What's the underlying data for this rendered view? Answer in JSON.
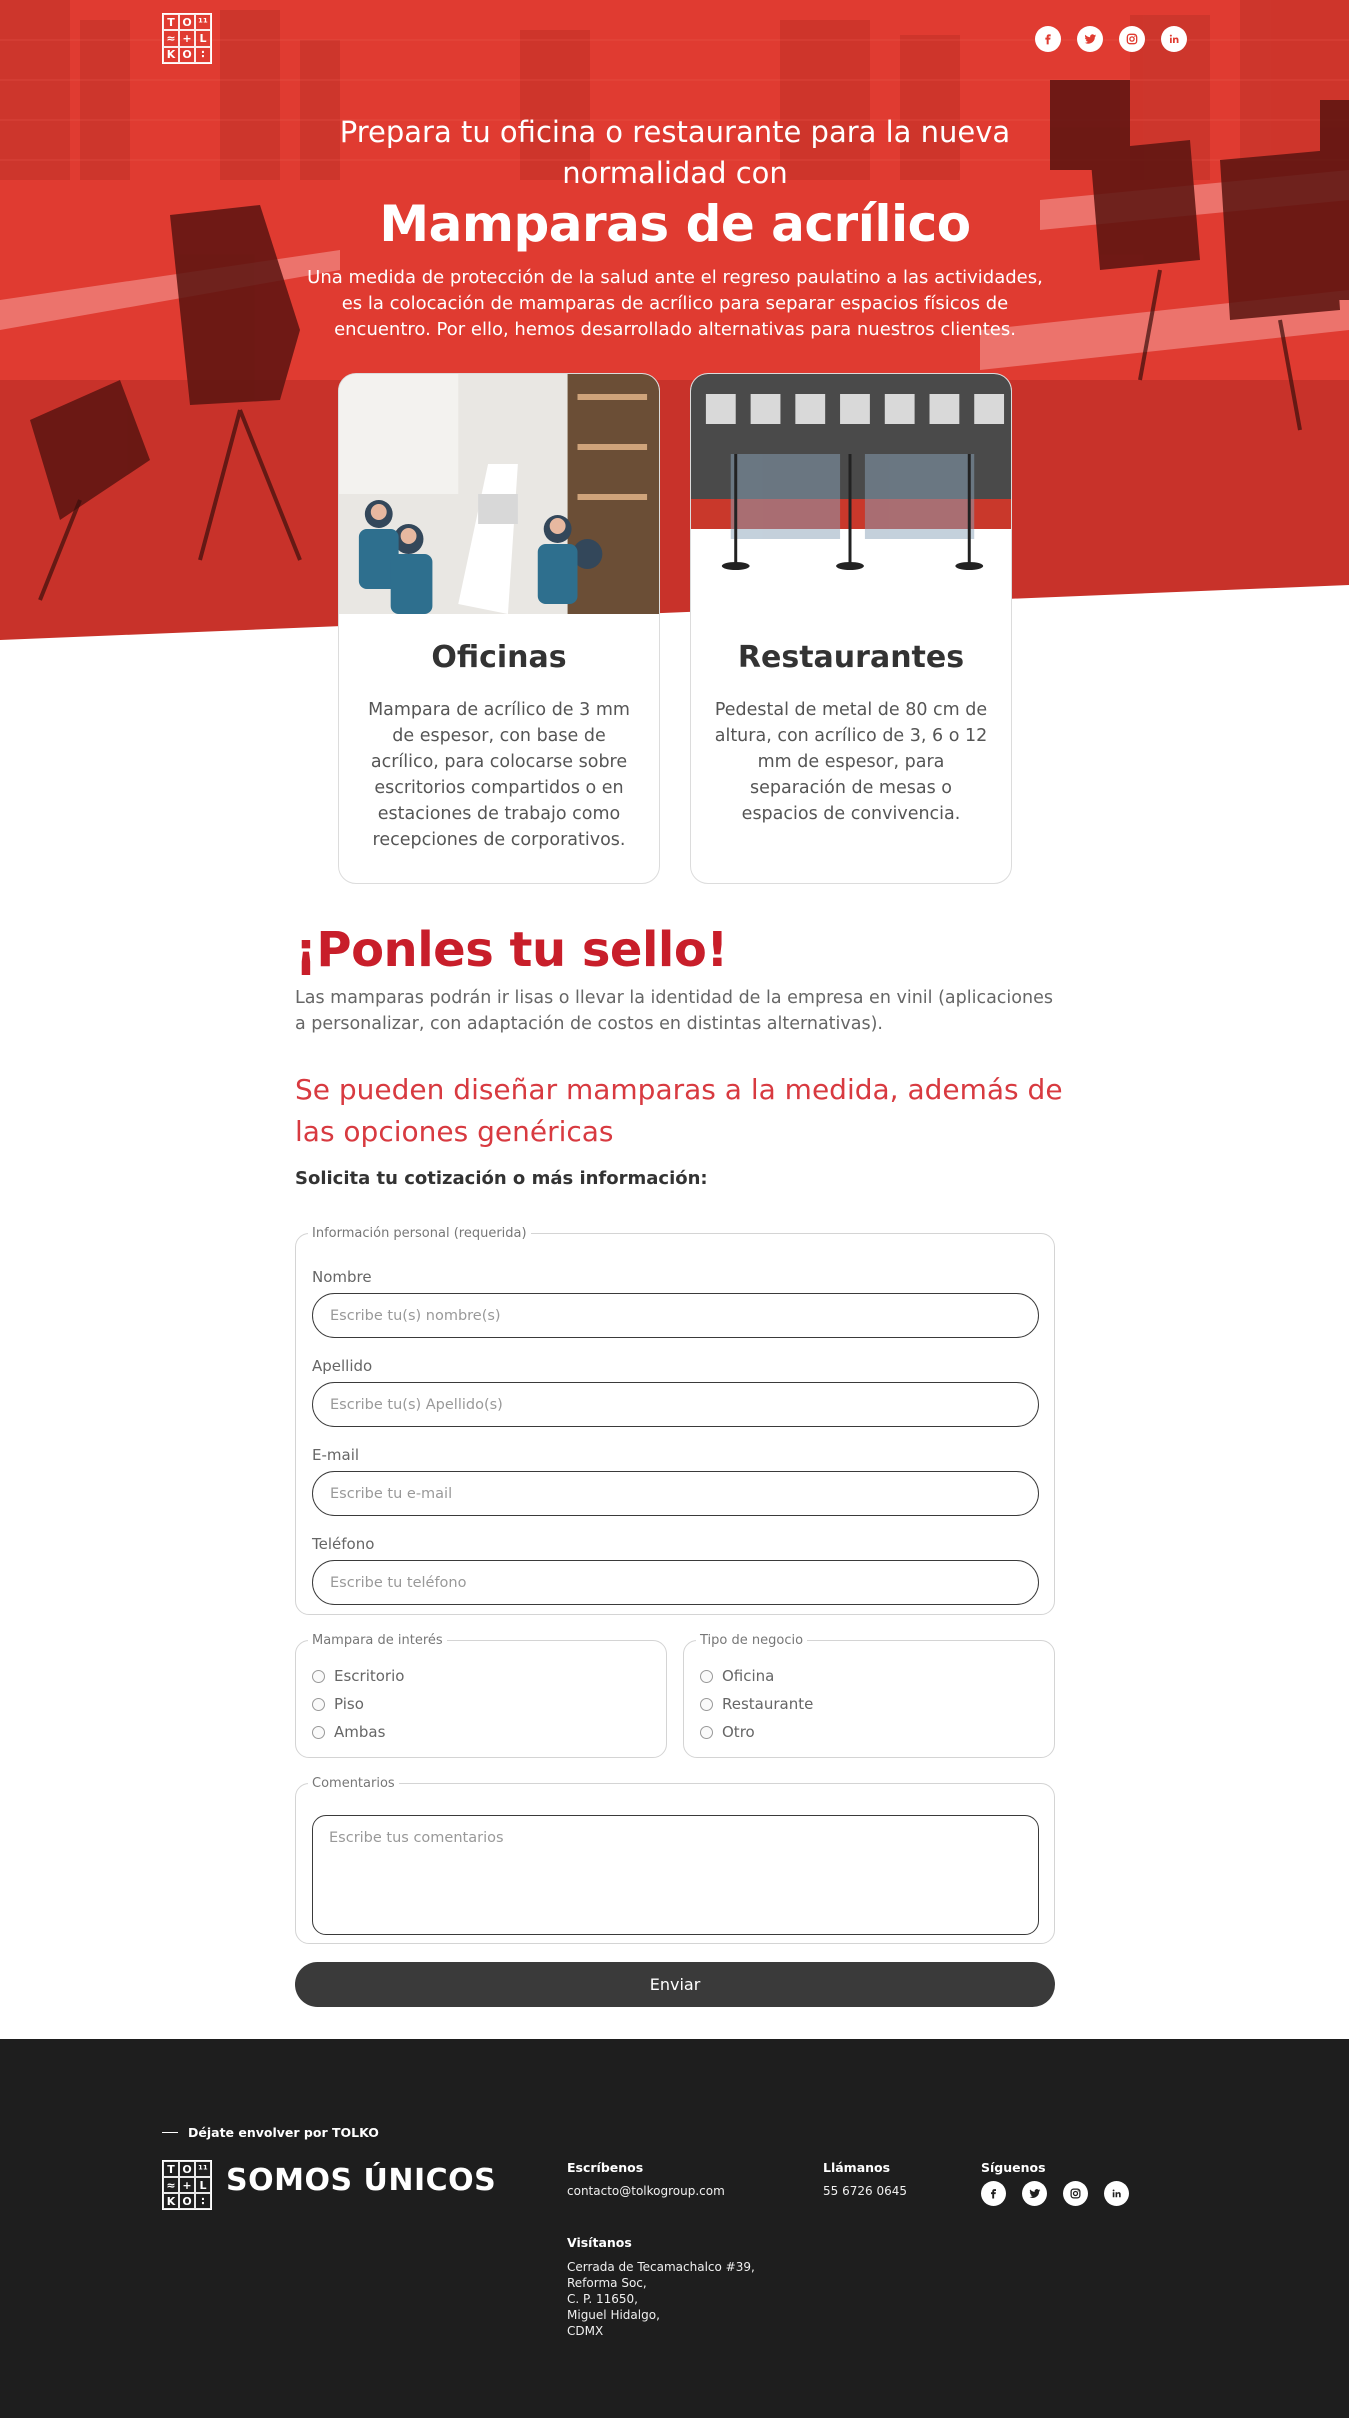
{
  "hero": {
    "subtitle": "Prepara tu oficina o restaurante para la nueva normalidad con",
    "title": "Mamparas de acrílico",
    "description": "Una medida de protección de la salud ante el regreso paulatino a las actividades, es la colocación de mamparas de acrílico para separar espacios físicos de encuentro. Por ello, hemos desarrollado alternativas para nuestros clientes."
  },
  "logo": {
    "cells": [
      "T",
      "O",
      "¹¹",
      "≈",
      "+",
      "L",
      "K",
      "O",
      "∶"
    ]
  },
  "social": [
    "facebook-icon",
    "twitter-icon",
    "instagram-icon",
    "linkedin-icon"
  ],
  "cards": [
    {
      "title": "Oficinas",
      "text": "Mampara de acrílico de 3 mm de espesor, con base de acrílico, para colocarse sobre escritorios compartidos o en estaciones de trabajo como recepciones de corporativos."
    },
    {
      "title": "Restaurantes",
      "text": "Pedestal de metal de 80 cm de altura, con acrílico de 3, 6 o 12 mm de espesor, para separación de mesas o espacios de convivencia."
    }
  ],
  "sello": {
    "title": "¡Ponles tu sello!",
    "text": "Las mamparas podrán ir lisas o llevar la identidad de la empresa en vinil (aplicaciones a personalizar, con adaptación de costos en distintas alternativas).",
    "subtitle": "Se pueden diseñar mamparas a la medida, además de las opciones genéricas",
    "cta": "Solicita tu cotización o más información:"
  },
  "form": {
    "personal_legend": "Información personal (requerida)",
    "fields": [
      {
        "label": "Nombre",
        "placeholder": "Escribe tu(s) nombre(s)"
      },
      {
        "label": "Apellido",
        "placeholder": "Escribe tu(s) Apellido(s)"
      },
      {
        "label": "E-mail",
        "placeholder": "Escribe tu e-mail"
      },
      {
        "label": "Teléfono",
        "placeholder": "Escribe tu teléfono"
      }
    ],
    "mampara_legend": "Mampara de interés",
    "mampara_options": [
      "Escritorio",
      "Piso",
      "Ambas"
    ],
    "negocio_legend": "Tipo de negocio",
    "negocio_options": [
      "Oficina",
      "Restaurante",
      "Otro"
    ],
    "comentarios_legend": "Comentarios",
    "comentarios_placeholder": "Escribe tus comentarios",
    "submit": "Enviar"
  },
  "footer": {
    "tagline": "Déjate envolver por TOLKO",
    "brand": "SOMOS ÚNICOS",
    "escribenos_title": "Escríbenos",
    "escribenos_value": "contacto@tolkogroup.com",
    "llamanos_title": "Llámanos",
    "llamanos_value": "55 6726 0645",
    "siguenos_title": "Síguenos",
    "visitanos_title": "Visítanos",
    "address": [
      "Cerrada de Tecamachalco #39,",
      "Reforma Soc,",
      "C. P. 11650,",
      "Miguel Hidalgo,",
      "CDMX"
    ]
  },
  "colors": {
    "brand_red": "#c81e2a",
    "hero_red": "#e23a30",
    "dark": "#1e1e1e"
  }
}
